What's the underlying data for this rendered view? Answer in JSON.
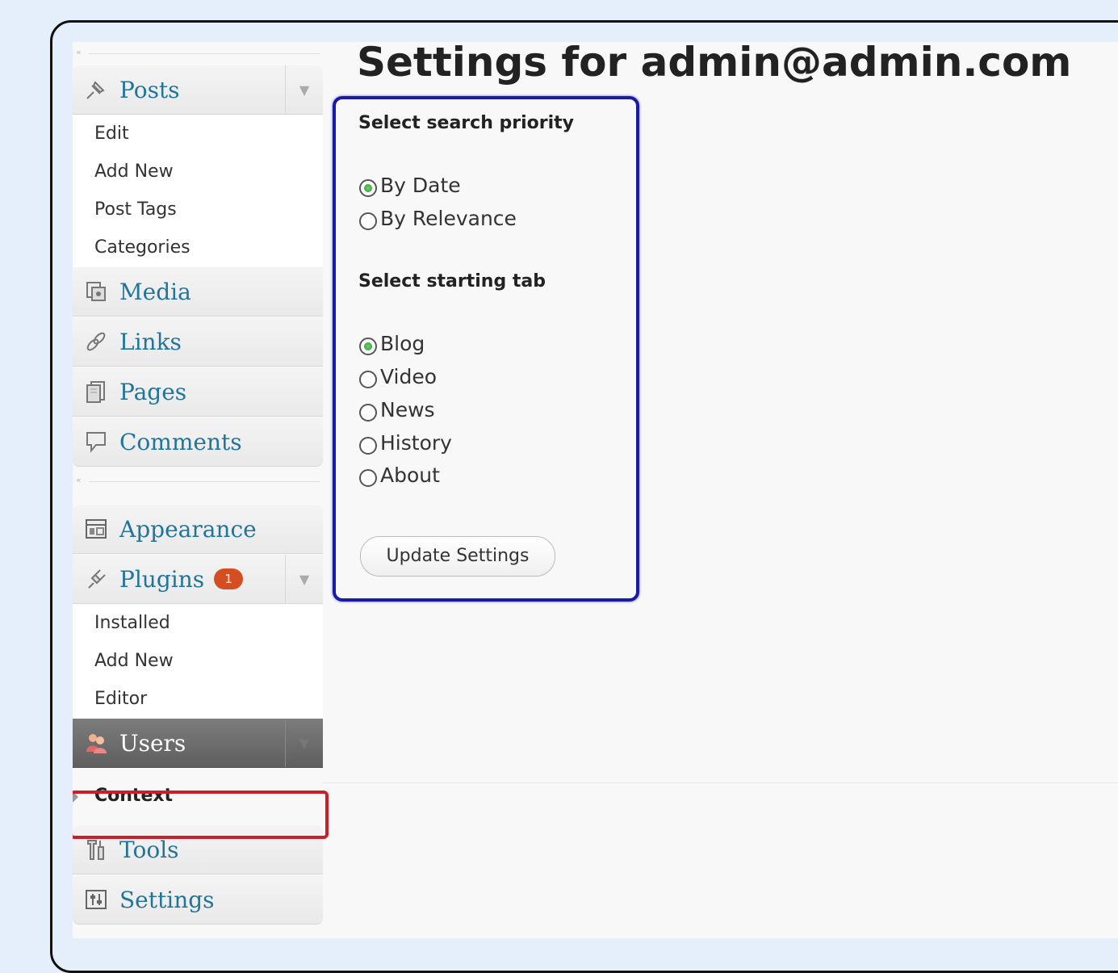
{
  "page": {
    "title": "Settings for admin@admin.com"
  },
  "sidebar": {
    "posts": {
      "label": "Posts",
      "items": [
        "Edit",
        "Add New",
        "Post Tags",
        "Categories"
      ]
    },
    "media": "Media",
    "links": "Links",
    "pages": "Pages",
    "comments": "Comments",
    "appearance": "Appearance",
    "plugins": {
      "label": "Plugins",
      "badge": "1",
      "items": [
        "Installed",
        "Add New",
        "Editor"
      ]
    },
    "users": "Users",
    "context": "Context",
    "tools": "Tools",
    "settings": "Settings",
    "collapse_glyph": "«",
    "toggle_glyph": "▼"
  },
  "form": {
    "priority_label": "Select search priority",
    "priority_options": [
      {
        "label": "By Date",
        "checked": true
      },
      {
        "label": "By Relevance",
        "checked": false
      }
    ],
    "tab_label": "Select starting tab",
    "tab_options": [
      {
        "label": "Blog",
        "checked": true
      },
      {
        "label": "Video",
        "checked": false
      },
      {
        "label": "News",
        "checked": false
      },
      {
        "label": "History",
        "checked": false
      },
      {
        "label": "About",
        "checked": false
      }
    ],
    "submit_label": "Update Settings"
  },
  "colors": {
    "link": "#21759b",
    "badge": "#d54e21",
    "highlight_red": "#c8202a",
    "highlight_blue": "#1a1aa8"
  }
}
